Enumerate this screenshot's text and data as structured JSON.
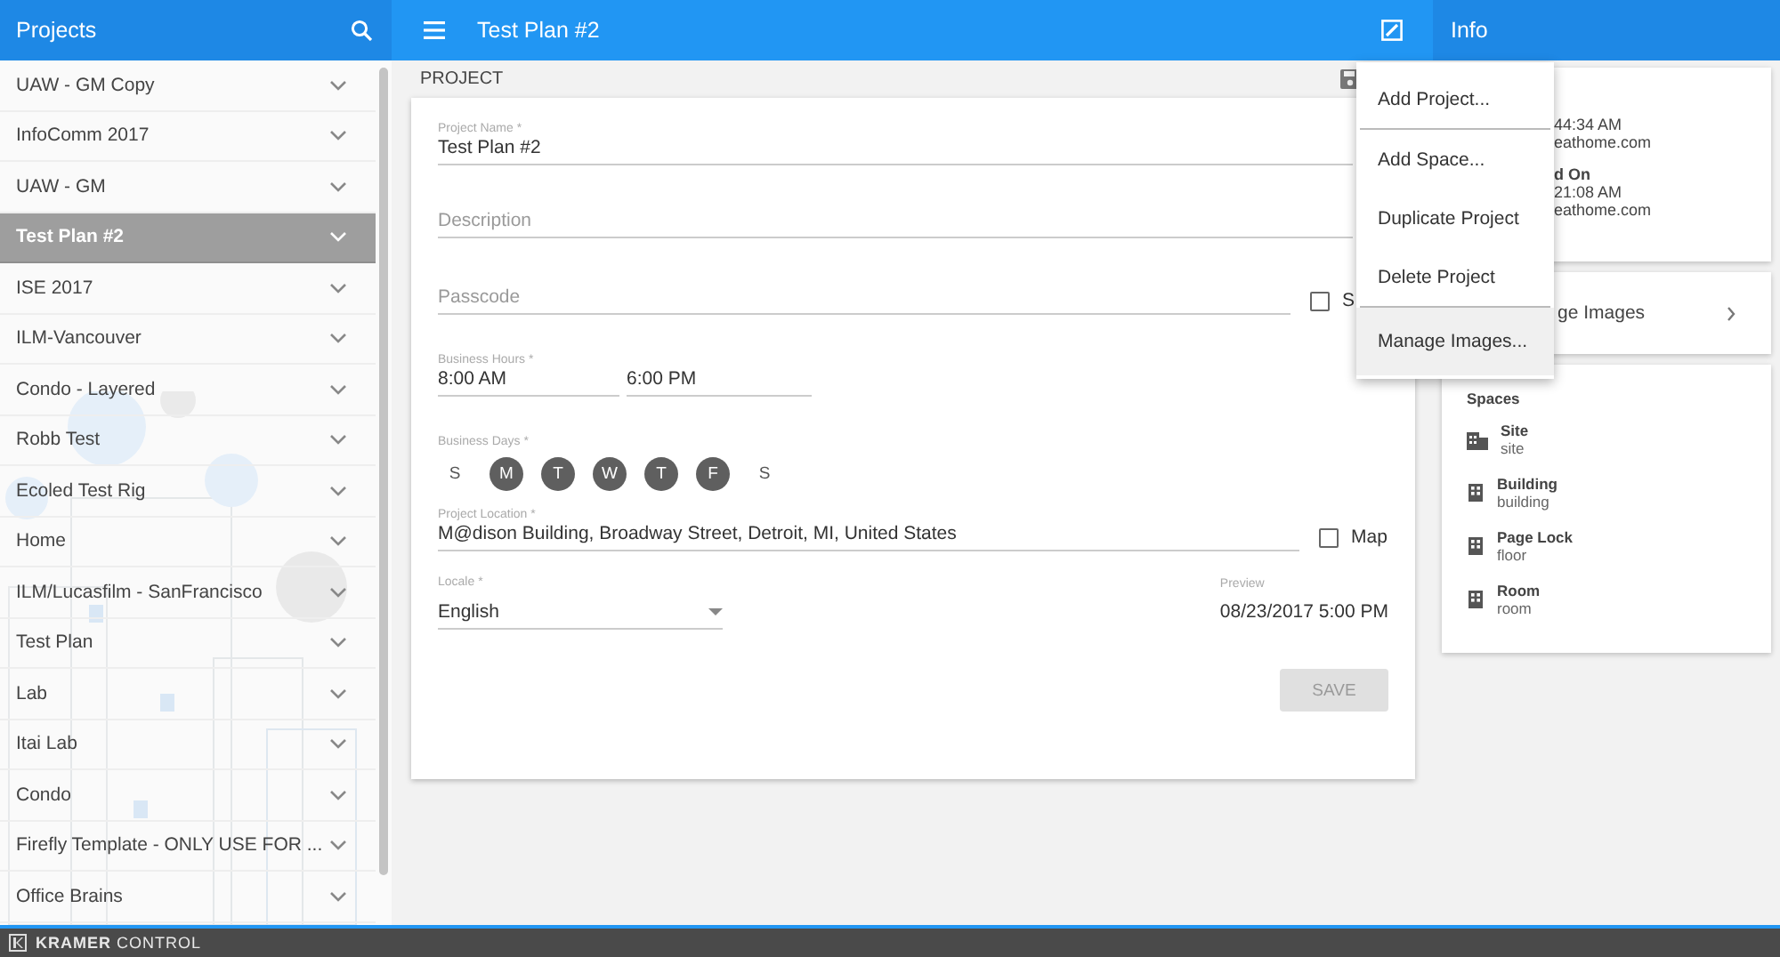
{
  "sidebar": {
    "title": "Projects",
    "items": [
      {
        "label": "UAW - GM Copy",
        "selected": false
      },
      {
        "label": "InfoComm 2017",
        "selected": false
      },
      {
        "label": "UAW - GM",
        "selected": false
      },
      {
        "label": "Test Plan #2",
        "selected": true
      },
      {
        "label": "ISE 2017",
        "selected": false
      },
      {
        "label": "ILM-Vancouver",
        "selected": false
      },
      {
        "label": "Condo - Layered",
        "selected": false
      },
      {
        "label": "Robb Test",
        "selected": false
      },
      {
        "label": "Ecoled Test Rig",
        "selected": false
      },
      {
        "label": "Home",
        "selected": false
      },
      {
        "label": "ILM/Lucasfilm - SanFrancisco",
        "selected": false
      },
      {
        "label": "Test Plan",
        "selected": false
      },
      {
        "label": "Lab",
        "selected": false
      },
      {
        "label": "Itai Lab",
        "selected": false
      },
      {
        "label": "Condo",
        "selected": false
      },
      {
        "label": "Firefly Template - ONLY USE FOR ...",
        "selected": false
      },
      {
        "label": "Office Brains",
        "selected": false
      }
    ]
  },
  "toolbar": {
    "title": "Test Plan #2"
  },
  "section": {
    "title": "PROJECT"
  },
  "form": {
    "project_name": {
      "label": "Project Name *",
      "value": "Test Plan #2"
    },
    "description": {
      "placeholder": "Description"
    },
    "passcode": {
      "placeholder": "Passcode"
    },
    "show_checkbox": {
      "label": "S",
      "checked": false
    },
    "business_hours": {
      "label": "Business Hours *",
      "start": "8:00 AM",
      "end": "6:00 PM"
    },
    "business_days": {
      "label": "Business Days *",
      "days": [
        {
          "label": "S",
          "selected": false
        },
        {
          "label": "M",
          "selected": true
        },
        {
          "label": "T",
          "selected": true
        },
        {
          "label": "W",
          "selected": true
        },
        {
          "label": "T",
          "selected": true
        },
        {
          "label": "F",
          "selected": true
        },
        {
          "label": "S",
          "selected": false
        }
      ]
    },
    "location": {
      "label": "Project Location *",
      "value": "M@dison Building, Broadway Street, Detroit, MI, United States"
    },
    "map_checkbox": {
      "label": "Map",
      "checked": false
    },
    "locale": {
      "label": "Locale *",
      "value": "English"
    },
    "preview": {
      "label": "Preview",
      "value": "08/23/2017 5:00 PM"
    },
    "save_button": {
      "label": "SAVE",
      "disabled": true
    }
  },
  "menu": {
    "items": [
      {
        "label": "Add Project...",
        "selected": false,
        "divider_after": true
      },
      {
        "label": "Add Space...",
        "selected": false,
        "divider_after": false
      },
      {
        "label": "Duplicate Project",
        "selected": false,
        "divider_after": false
      },
      {
        "label": "Delete Project",
        "selected": false,
        "divider_after": true
      },
      {
        "label": "Manage Images...",
        "selected": true,
        "divider_after": false
      }
    ]
  },
  "info_panel": {
    "title": "Info",
    "details": [
      {
        "text": "44:34 AM",
        "kind": "value"
      },
      {
        "text": "eathome.com",
        "kind": "value"
      },
      {
        "text": "d On",
        "kind": "heading"
      },
      {
        "text": "21:08 AM",
        "kind": "value"
      },
      {
        "text": "eathome.com",
        "kind": "value"
      }
    ],
    "images_link": "ge Images",
    "spaces": {
      "title": "Spaces",
      "items": [
        {
          "name": "Site",
          "type": "site",
          "kind": "site"
        },
        {
          "name": "Building",
          "type": "building",
          "kind": "building"
        },
        {
          "name": "Page Lock",
          "type": "floor",
          "kind": "floor"
        },
        {
          "name": "Room",
          "type": "room",
          "kind": "room"
        }
      ]
    }
  },
  "footer": {
    "brand": "KRAMER",
    "product": "CONTROL"
  }
}
